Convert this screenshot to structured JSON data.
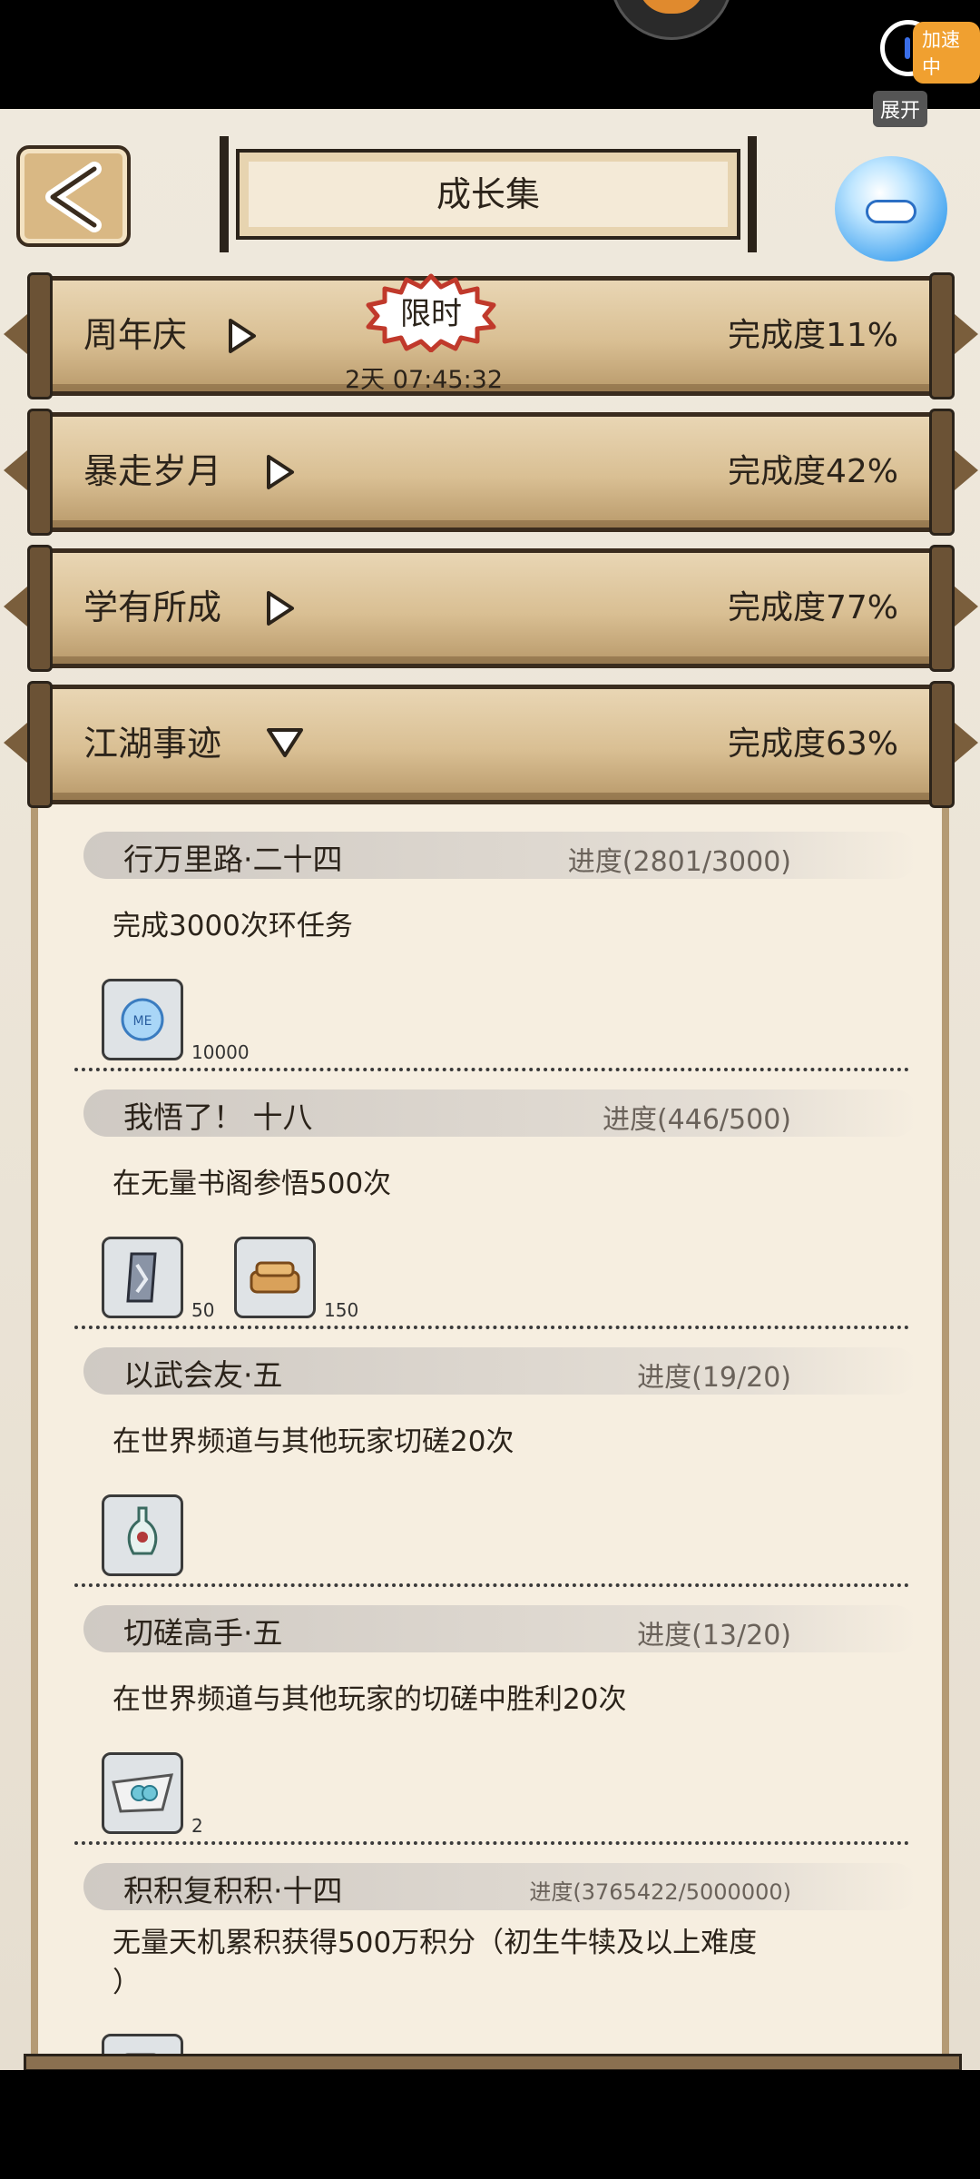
{
  "status": {
    "accel_badge": "加速中",
    "expand_label": "展开"
  },
  "header": {
    "title": "成长集"
  },
  "categories": [
    {
      "name": "周年庆",
      "progress": "完成度11%",
      "limited_label": "限时",
      "timer": "2天 07:45:32"
    },
    {
      "name": "暴走岁月",
      "progress": "完成度42%"
    },
    {
      "name": "学有所成",
      "progress": "完成度77%"
    },
    {
      "name": "江湖事迹",
      "progress": "完成度63%"
    }
  ],
  "tasks": [
    {
      "name": "行万里路·二十四",
      "progress": "进度(2801/3000)",
      "desc": "完成3000次环任务",
      "rewards": [
        {
          "icon": "silver-coin-icon",
          "count": "10000"
        }
      ]
    },
    {
      "name": "我悟了！ 十八",
      "progress": "进度(446/500)",
      "desc": "在无量书阁参悟500次",
      "rewards": [
        {
          "icon": "token-card-icon",
          "count": "50"
        },
        {
          "icon": "scroll-bundle-icon",
          "count": "150"
        }
      ]
    },
    {
      "name": "以武会友·五",
      "progress": "进度(19/20)",
      "desc": "在世界频道与其他玩家切磋20次",
      "rewards": [
        {
          "icon": "vase-icon",
          "count": ""
        }
      ]
    },
    {
      "name": "切磋高手·五",
      "progress": "进度(13/20)",
      "desc": "在世界频道与其他玩家的切磋中胜利20次",
      "rewards": [
        {
          "icon": "jade-envelope-icon",
          "count": "2"
        }
      ]
    },
    {
      "name": "积积复积积·十四",
      "progress": "进度(3765422/5000000)",
      "desc": "无量天机累积获得500万积分（初生牛犊及以上难度\n）",
      "rewards": [
        {
          "icon": "dice-icon",
          "count": ""
        }
      ]
    }
  ]
}
